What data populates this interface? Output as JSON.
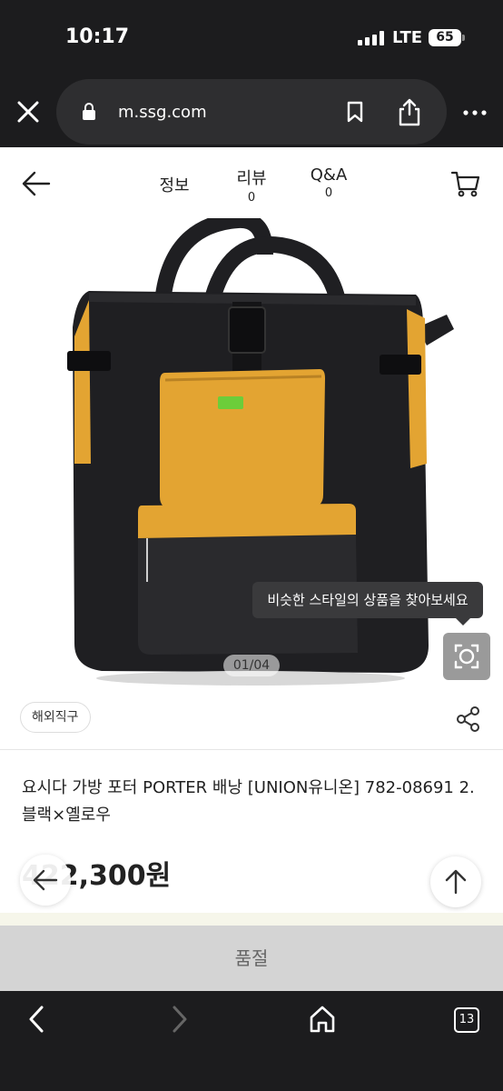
{
  "status_bar": {
    "time": "10:17",
    "network": "LTE",
    "battery": "65"
  },
  "browser": {
    "url": "m.ssg.com"
  },
  "nav": {
    "tabs": [
      {
        "label": "정보",
        "count": ""
      },
      {
        "label": "리뷰",
        "count": "0"
      },
      {
        "label": "Q&A",
        "count": "0"
      }
    ]
  },
  "gallery": {
    "tooltip": "비슷한 스타일의 상품을 찾아보세요",
    "counter": "01/04",
    "image": "black and yellow PORTER backpack tote bag"
  },
  "product": {
    "badge": "해외직구",
    "title": "요시다 가방 포터 PORTER 배낭 [UNION유니온] 782-08691 2.블랙×옐로우",
    "price": "422,300원"
  },
  "cta": {
    "label": "품절"
  },
  "toolbar": {
    "tabs_count": "13"
  },
  "colors": {
    "bag_black": "#1f1f22",
    "bag_yellow": "#e3a432",
    "soldout_bg": "#d4d4d4",
    "browser_chrome": "#1c1c1e"
  },
  "icons": [
    "close-icon",
    "lock-icon",
    "bookmark-icon",
    "share-icon",
    "more-icon",
    "back-arrow-icon",
    "cart-icon",
    "lens-search-icon",
    "share-nodes-icon",
    "arrow-up-icon",
    "chevron-left-icon",
    "chevron-right-icon",
    "home-icon"
  ]
}
